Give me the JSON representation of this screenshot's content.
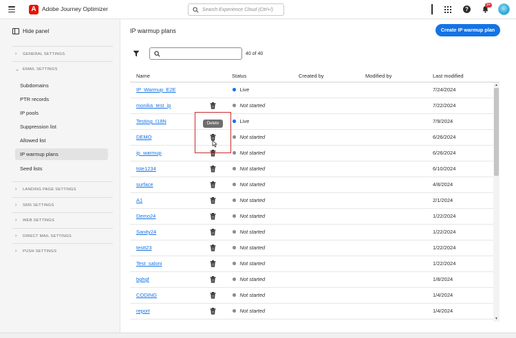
{
  "app": {
    "title": "Adobe Journey Optimizer",
    "logo_letter": "A",
    "search_placeholder": "Search Experience Cloud (Ctrl+/)",
    "notification_count": "9+"
  },
  "sidebar": {
    "hide_panel_label": "Hide panel",
    "groups": [
      {
        "label": "GENERAL SETTINGS",
        "expanded": false
      },
      {
        "label": "EMAIL SETTINGS",
        "expanded": true
      },
      {
        "label": "LANDING PAGE SETTINGS",
        "expanded": false
      },
      {
        "label": "SMS SETTINGS",
        "expanded": false
      },
      {
        "label": "WEB SETTINGS",
        "expanded": false
      },
      {
        "label": "DIRECT MAIL SETTINGS",
        "expanded": false
      },
      {
        "label": "PUSH SETTINGS",
        "expanded": false
      }
    ],
    "email_items": [
      {
        "label": "Subdomains",
        "active": false
      },
      {
        "label": "PTR records",
        "active": false
      },
      {
        "label": "IP pools",
        "active": false
      },
      {
        "label": "Suppression list",
        "active": false
      },
      {
        "label": "Allowed list",
        "active": false
      },
      {
        "label": "IP warmup plans",
        "active": true
      },
      {
        "label": "Seed lists",
        "active": false
      }
    ]
  },
  "main": {
    "title": "IP warmup plans",
    "create_button": "Create IP warmup plan",
    "search_value": "",
    "count": "40 of 40",
    "columns": [
      "Name",
      "Status",
      "Created by",
      "Modified by",
      "Last modified"
    ],
    "rows": [
      {
        "name": "IP_Warmup_E2E",
        "status": "Live",
        "created_by": "",
        "modified_by": "",
        "last_modified": "7/24/2024",
        "deletable": false
      },
      {
        "name": "monika_test_ip",
        "status": "Not started",
        "created_by": "",
        "modified_by": "",
        "last_modified": "7/22/2024",
        "deletable": true
      },
      {
        "name": "Testing_I18N",
        "status": "Live",
        "created_by": "",
        "modified_by": "",
        "last_modified": "7/9/2024",
        "deletable": false
      },
      {
        "name": "DEMO",
        "status": "Not started",
        "created_by": "",
        "modified_by": "",
        "last_modified": "6/26/2024",
        "deletable": true
      },
      {
        "name": "ip_warmup",
        "status": "Not started",
        "created_by": "",
        "modified_by": "",
        "last_modified": "6/26/2024",
        "deletable": true
      },
      {
        "name": "tste1234",
        "status": "Not started",
        "created_by": "",
        "modified_by": "",
        "last_modified": "6/10/2024",
        "deletable": true
      },
      {
        "name": "surface",
        "status": "Not started",
        "created_by": "",
        "modified_by": "",
        "last_modified": "4/8/2024",
        "deletable": true
      },
      {
        "name": "A1",
        "status": "Not started",
        "created_by": "",
        "modified_by": "",
        "last_modified": "2/1/2024",
        "deletable": true
      },
      {
        "name": "Demo24",
        "status": "Not started",
        "created_by": "",
        "modified_by": "",
        "last_modified": "1/22/2024",
        "deletable": true
      },
      {
        "name": "Sanity24",
        "status": "Not started",
        "created_by": "",
        "modified_by": "",
        "last_modified": "1/22/2024",
        "deletable": true
      },
      {
        "name": "testt23",
        "status": "Not started",
        "created_by": "",
        "modified_by": "",
        "last_modified": "1/22/2024",
        "deletable": true
      },
      {
        "name": "Test_saloni",
        "status": "Not started",
        "created_by": "",
        "modified_by": "",
        "last_modified": "1/22/2024",
        "deletable": true
      },
      {
        "name": "bghgf",
        "status": "Not started",
        "created_by": "",
        "modified_by": "",
        "last_modified": "1/8/2024",
        "deletable": true
      },
      {
        "name": "CODING",
        "status": "Not started",
        "created_by": "",
        "modified_by": "",
        "last_modified": "1/4/2024",
        "deletable": true
      },
      {
        "name": "report",
        "status": "Not started",
        "created_by": "",
        "modified_by": "",
        "last_modified": "1/4/2024",
        "deletable": true
      }
    ],
    "tooltip": "Delete"
  },
  "colors": {
    "accent": "#1473e6",
    "live_dot": "#1473e6",
    "not_started_dot": "#8e8e8e",
    "brand": "#eb1000",
    "highlight": "#c42a2a"
  },
  "icons": [
    "menu-icon",
    "adobe-logo-icon",
    "search-icon",
    "apps-grid-icon",
    "help-icon",
    "bell-icon",
    "panel-icon",
    "chevron-right-icon",
    "chevron-down-icon",
    "filter-icon",
    "trash-icon",
    "cursor-icon"
  ]
}
